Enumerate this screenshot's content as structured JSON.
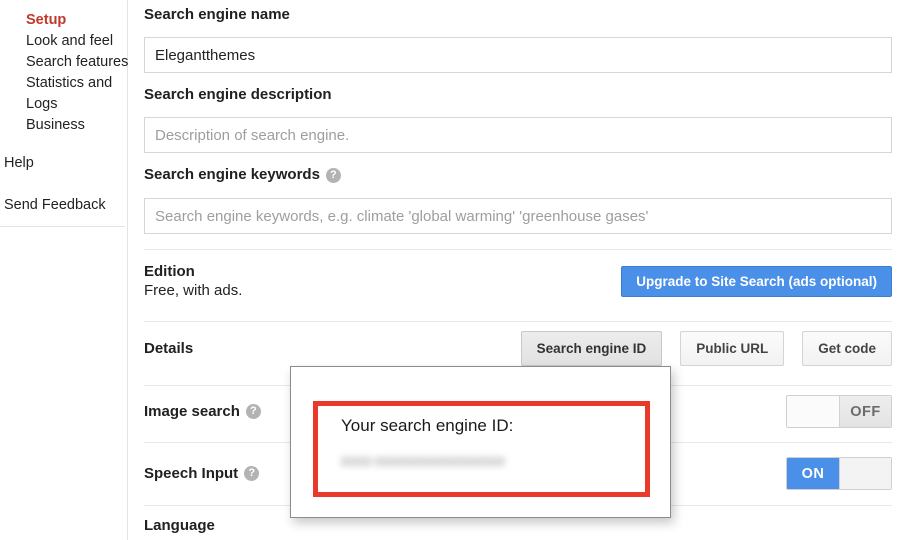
{
  "sidebar": {
    "primary_items": [
      {
        "label": "Setup",
        "active": true
      },
      {
        "label": "Look and feel",
        "active": false
      },
      {
        "label": "Search features",
        "active": false
      },
      {
        "label": "Statistics and Logs",
        "active": false
      },
      {
        "label": "Business",
        "active": false
      }
    ],
    "help_label": "Help",
    "feedback_label": "Send Feedback"
  },
  "form": {
    "name_label": "Search engine name",
    "name_value": "Elegantthemes",
    "description_label": "Search engine description",
    "description_placeholder": "Description of search engine.",
    "description_value": "",
    "keywords_label": "Search engine keywords",
    "keywords_placeholder": "Search engine keywords, e.g. climate 'global warming' 'greenhouse gases'",
    "keywords_value": "",
    "help_icon_glyph": "?"
  },
  "edition": {
    "title": "Edition",
    "subtitle": "Free, with ads.",
    "upgrade_button": "Upgrade to Site Search (ads optional)"
  },
  "details": {
    "title": "Details",
    "buttons": [
      {
        "label": "Search engine ID",
        "pressed": true
      },
      {
        "label": "Public URL",
        "pressed": false
      },
      {
        "label": "Get code",
        "pressed": false
      }
    ]
  },
  "image_search": {
    "label": "Image search",
    "toggle_state": "OFF"
  },
  "speech_input": {
    "label": "Speech Input",
    "toggle_state": "ON"
  },
  "language": {
    "label": "Language"
  },
  "popup": {
    "title": "Your search engine ID:",
    "id_value": "0000:00000000000000000",
    "border_color": "#e8392b"
  },
  "colors": {
    "accent_red": "#c0392b",
    "primary_blue": "#4a90e8",
    "popup_red": "#e8392b",
    "border_gray": "#d6d6d6",
    "placeholder_gray": "#9e9e9e"
  }
}
